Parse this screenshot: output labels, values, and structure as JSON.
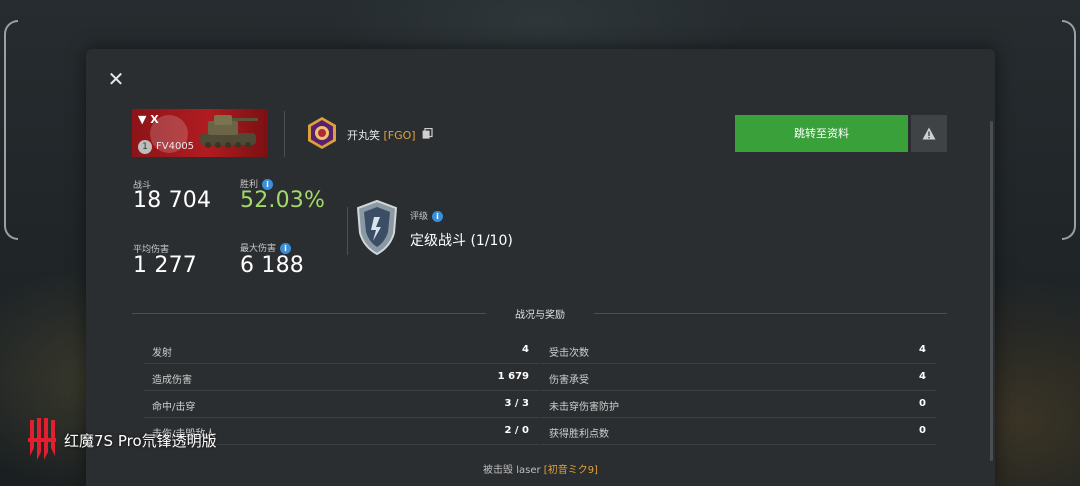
{
  "dialog": {
    "tank": {
      "name": "FV4005",
      "tier": "1",
      "flag_text": "▼ X"
    },
    "player": {
      "name": "开丸笑",
      "clan_tag": "[FGO]"
    },
    "profile_button_label": "跳转至资料",
    "stats": {
      "battles": {
        "label": "战斗",
        "value": "18 704"
      },
      "win_rate": {
        "label": "胜利",
        "value": "52.03%"
      },
      "avg_damage": {
        "label": "平均伤害",
        "value": "1 277"
      },
      "max_damage": {
        "label": "最大伤害",
        "value": "6 188"
      }
    },
    "rating": {
      "label": "评级",
      "value": "定级战斗 (1/10)"
    },
    "section_title": "战况与奖励",
    "battle_stats_left": [
      {
        "label": "发射",
        "value": "4"
      },
      {
        "label": "造成伤害",
        "value": "1 679"
      },
      {
        "label": "命中/击穿",
        "value": "3 / 3"
      },
      {
        "label": "击伤/击毁敌人",
        "value": "2 / 0"
      }
    ],
    "battle_stats_right": [
      {
        "label": "受击次数",
        "value": "4"
      },
      {
        "label": "伤害承受",
        "value": "4"
      },
      {
        "label": "未击穿伤害防护",
        "value": "0"
      },
      {
        "label": "获得胜利点数",
        "value": "0"
      }
    ],
    "killed_by": {
      "prefix": "被击毁",
      "name": "laser",
      "clan_tag": "[初音ミク9]"
    }
  },
  "watermark": {
    "text": "红魔7S Pro氘锋透明版"
  },
  "colors": {
    "accent_green": "#3aa13a",
    "win_rate_green": "#a3d96b",
    "clan_tag_orange": "#e0a33a",
    "info_blue": "#3a8fd8"
  }
}
